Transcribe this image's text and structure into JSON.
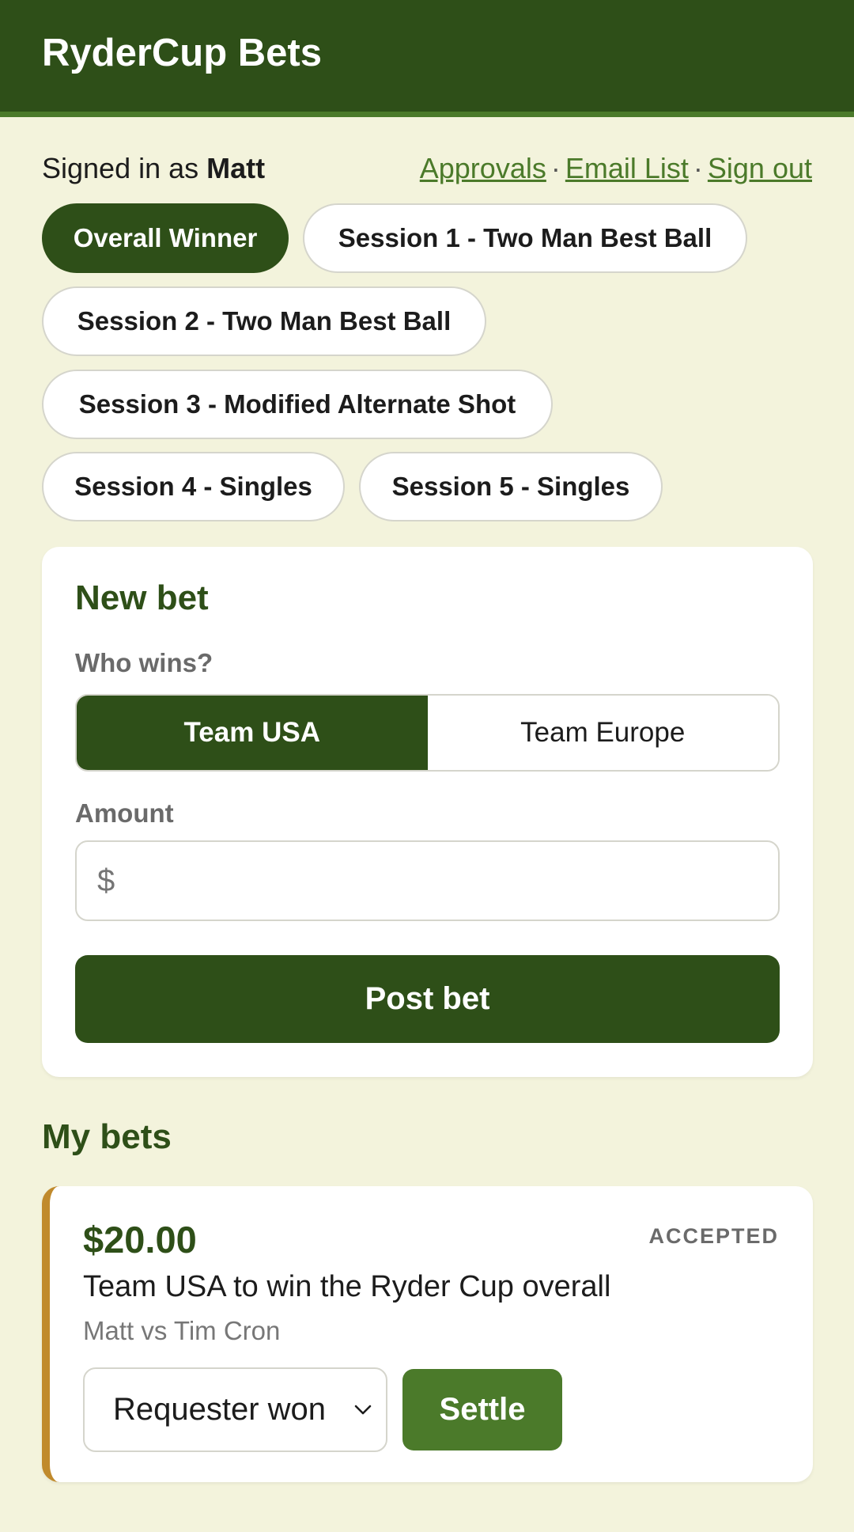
{
  "app": {
    "title": "RyderCup Bets"
  },
  "user": {
    "signed_in_prefix": "Signed in as",
    "name": "Matt",
    "links": {
      "approvals": "Approvals",
      "email_list": "Email List",
      "sign_out": "Sign out"
    },
    "separator": "·"
  },
  "sessions": [
    {
      "label": "Overall Winner",
      "active": true
    },
    {
      "label": "Session 1 - Two Man Best Ball",
      "active": false
    },
    {
      "label": "Session 2 - Two Man Best Ball",
      "active": false
    },
    {
      "label": "Session 3 - Modified Alternate Shot",
      "active": false
    },
    {
      "label": "Session 4 - Singles",
      "active": false
    },
    {
      "label": "Session 5 - Singles",
      "active": false
    }
  ],
  "new_bet": {
    "heading": "New bet",
    "who_wins_label": "Who wins?",
    "options": [
      "Team USA",
      "Team Europe"
    ],
    "selected": "Team USA",
    "amount_label": "Amount",
    "amount_placeholder": "$",
    "amount_value": "",
    "submit_label": "Post bet"
  },
  "my_bets": {
    "heading": "My bets",
    "bets": [
      {
        "amount": "$20.00",
        "status": "ACCEPTED",
        "description": "Team USA to win the Ryder Cup overall",
        "matchup": "Matt vs Tim Cron",
        "outcome_selected": "Requester won",
        "settle_label": "Settle"
      }
    ]
  },
  "colors": {
    "header_bg": "#2e4f18",
    "page_bg": "#f3f3dc",
    "accent": "#4b7a2a",
    "pending_stripe": "#c08a2c"
  }
}
